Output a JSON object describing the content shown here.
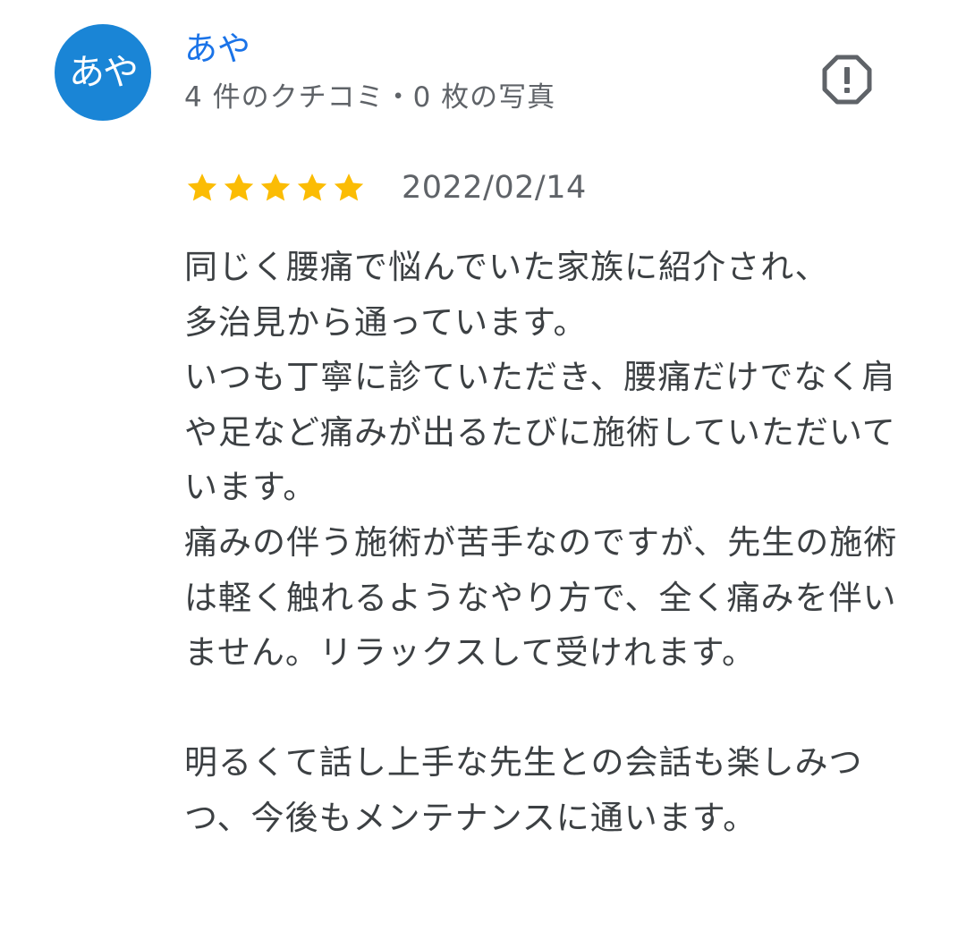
{
  "reviewer": {
    "avatar_text": "あや",
    "name": "あや",
    "meta": "4 件のクチコミ・0 枚の写真",
    "avatar_color": "#1a85d6"
  },
  "report_icon": "report-flag-octagon-icon",
  "rating": {
    "stars": 5,
    "max": 5,
    "star_color": "#fbbc04",
    "date": "2022/02/14"
  },
  "review_text": "同じく腰痛で悩んでいた家族に紹介され、\n多治見から通っています。\nいつも丁寧に診ていただき、腰痛だけでなく肩や足など痛みが出るたびに施術していただいています。\n痛みの伴う施術が苦手なのですが、先生の施術は軽く触れるようなやり方で、全く痛みを伴いません。リラックスして受けれます。\n\n明るくて話し上手な先生との会話も楽しみつつ、今後もメンテナンスに通います。"
}
